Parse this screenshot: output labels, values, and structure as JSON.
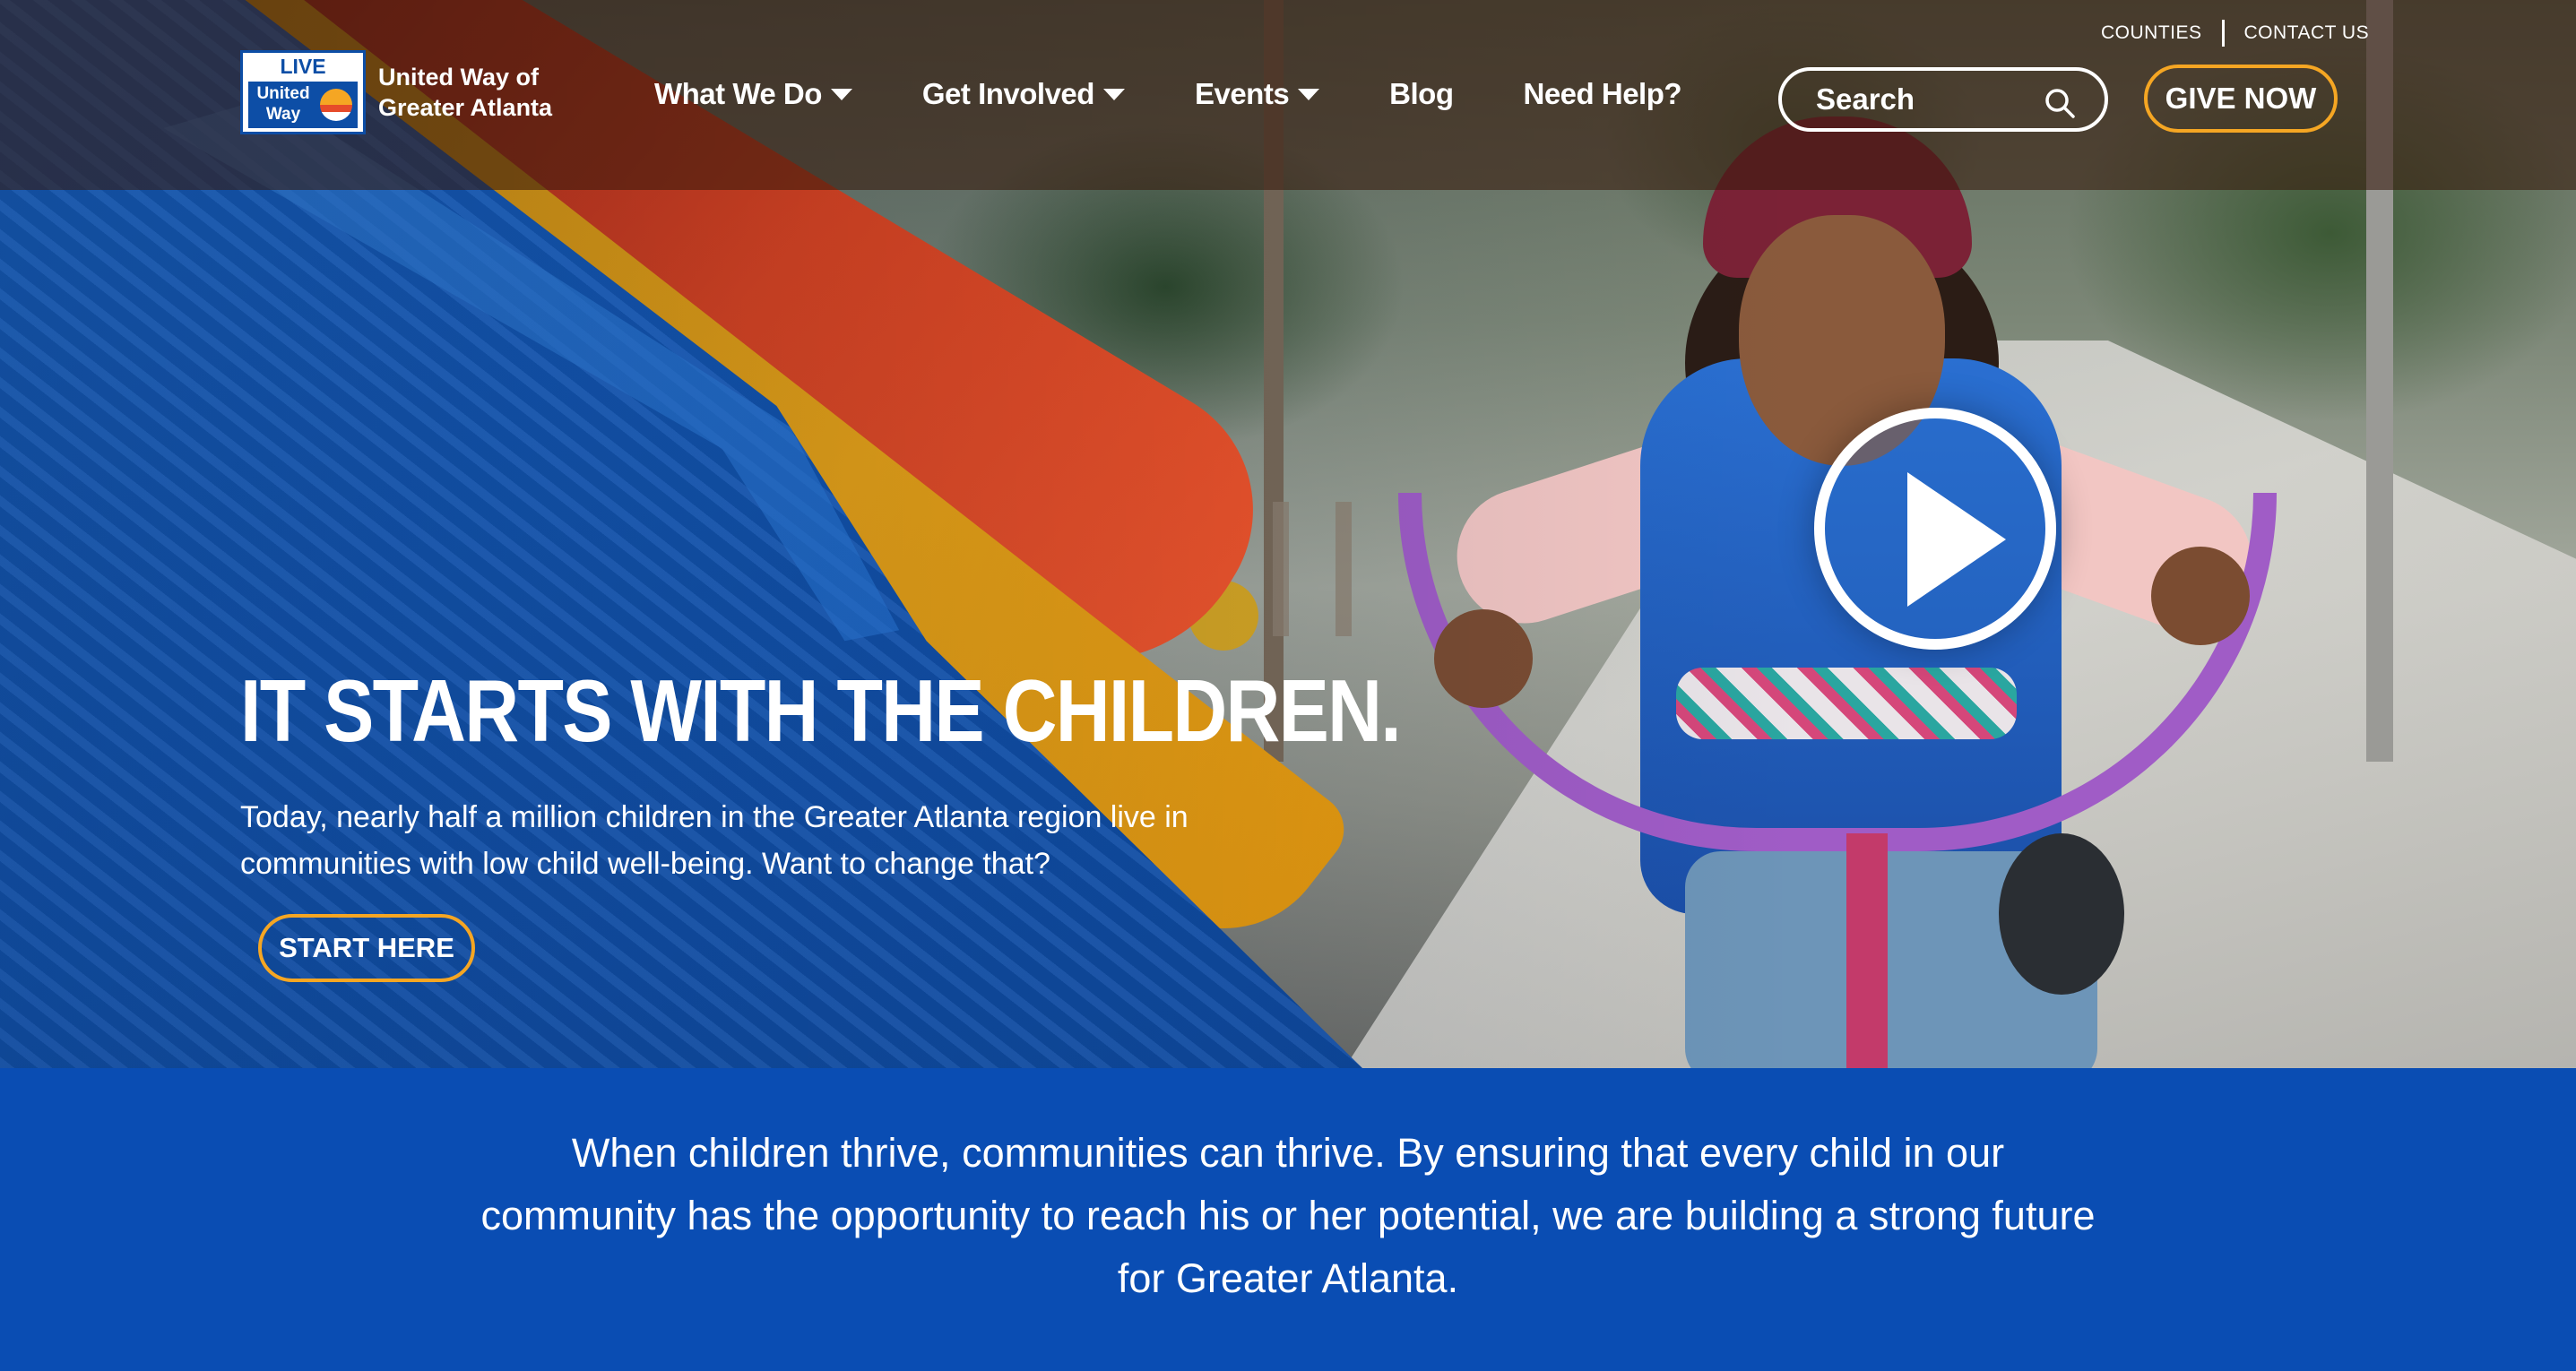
{
  "header": {
    "logo": {
      "top_text": "LIVE UNITED",
      "mark_text": "United Way",
      "org_name": "United Way of Greater Atlanta"
    },
    "nav": [
      {
        "label": "What We Do",
        "has_dropdown": true
      },
      {
        "label": "Get Involved",
        "has_dropdown": true
      },
      {
        "label": "Events",
        "has_dropdown": true
      },
      {
        "label": "Blog",
        "has_dropdown": false
      },
      {
        "label": "Need Help?",
        "has_dropdown": false
      }
    ],
    "utility_links": [
      "COUNTIES",
      "CONTACT US"
    ],
    "search": {
      "placeholder": "Search",
      "icon": "search-icon"
    },
    "give_label": "GIVE NOW"
  },
  "hero": {
    "headline": "IT STARTS WITH THE CHILDREN.",
    "subtext": "Today, nearly half a million children in the Greater Atlanta region live in communities with low child well-being. Want to change that?",
    "cta_label": "START HERE",
    "play_icon": "play-icon"
  },
  "band": {
    "text": "When children thrive, communities can thrive. By ensuring that every child in our community has the opportunity to reach his or her potential, we are building a strong future for Greater Atlanta."
  },
  "colors": {
    "brand_blue": "#0a4db3",
    "accent_gold": "#f5a623",
    "header_overlay": "#37190c"
  }
}
